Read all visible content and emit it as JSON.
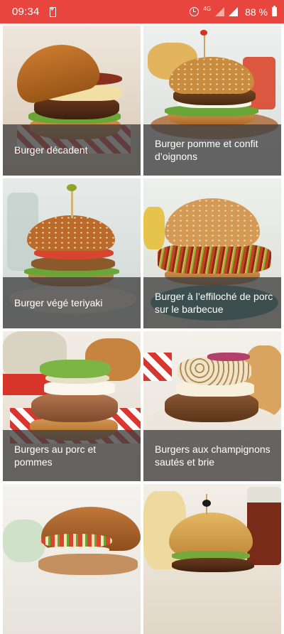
{
  "status_bar": {
    "time": "09:34",
    "network": "4G",
    "battery": "88 %"
  },
  "recipes": [
    {
      "title": "Burger décadent"
    },
    {
      "title": "Burger pomme et confit d’oignons"
    },
    {
      "title": "Burger végé teriyaki"
    },
    {
      "title": "Burger à l’effiloché de porc sur le barbecue"
    },
    {
      "title": "Burgers au porc et pommes"
    },
    {
      "title": "Burgers aux champignons sautés et brie"
    },
    {
      "title": ""
    },
    {
      "title": ""
    }
  ],
  "colors": {
    "status_bar": "#e9453f",
    "caption_overlay": "rgba(64,64,64,0.78)"
  }
}
